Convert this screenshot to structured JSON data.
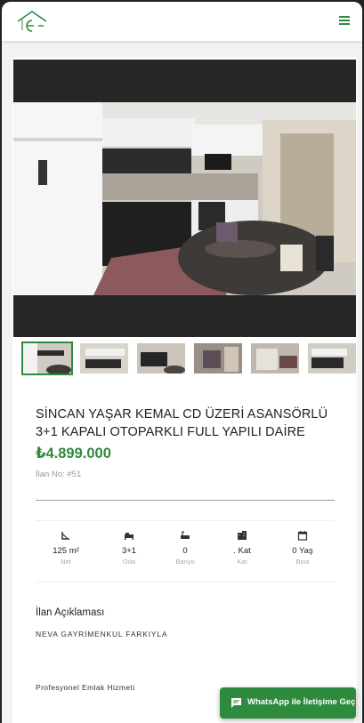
{
  "header": {
    "logo_icon": "house-logo-icon",
    "menu_icon": "hamburger-menu-icon",
    "brand_color": "#2e8b3d"
  },
  "listing": {
    "title": "SİNCAN YAŞAR KEMAL CD ÜZERİ ASANSÖRLÜ 3+1 KAPALI OTOPARKLI FULL YAPILI DAİRE",
    "price": "₺4.899.000",
    "listing_no": "İlan No: #51"
  },
  "gallery": {
    "selected_index": 0,
    "thumbnail_count": 6
  },
  "features": [
    {
      "icon": "area-icon",
      "value": "125 m²",
      "label": "Net"
    },
    {
      "icon": "bed-icon",
      "value": "3+1",
      "label": "Oda"
    },
    {
      "icon": "bath-icon",
      "value": "0",
      "label": "Banyo"
    },
    {
      "icon": "building-icon",
      "value": ". Kat",
      "label": "Kat"
    },
    {
      "icon": "calendar-icon",
      "value": "0 Yaş",
      "label": "Bina"
    }
  ],
  "description": {
    "heading": "İlan Açıklaması",
    "line1": "NEVA GAYRİMENKUL FARKIYLA",
    "line2": "Profesyonel Emlak Hizmeti"
  },
  "whatsapp": {
    "label": "WhatsApp ile İletişime Geç",
    "icon": "chat-icon"
  }
}
